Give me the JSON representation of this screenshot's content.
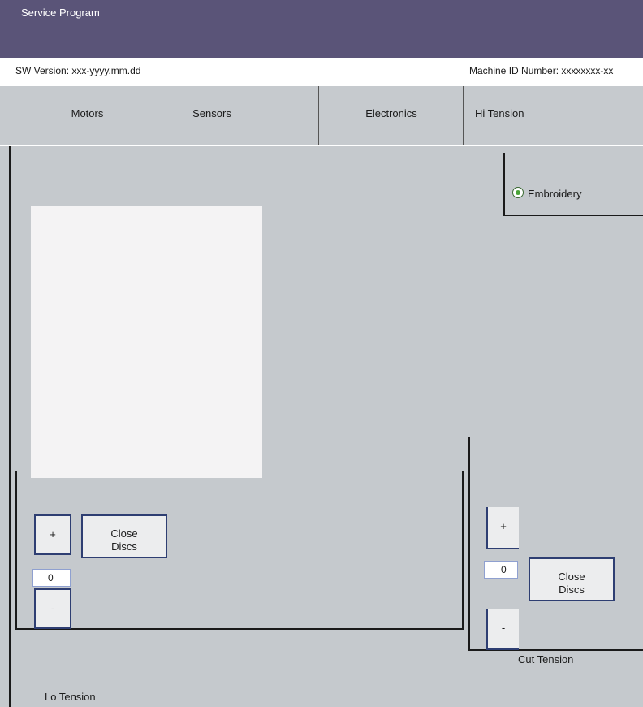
{
  "window": {
    "title": "Service Program"
  },
  "info": {
    "sw_version": "SW Version: xxx-yyyy.mm.dd",
    "machine_id": "Machine ID Number: xxxxxxxx-xx"
  },
  "tabs": [
    {
      "label": "Motors"
    },
    {
      "label": "Sensors"
    },
    {
      "label": "Electronics"
    },
    {
      "label": "Hi Tension"
    }
  ],
  "mode": {
    "embroidery_label": "Embroidery",
    "embroidery_selected": true
  },
  "lo_tension": {
    "label": "Lo Tension",
    "plus_label": "+",
    "minus_label": "-",
    "value": "0",
    "close_discs_label": "Close\nDiscs"
  },
  "cut_tension": {
    "label": "Cut Tension",
    "plus_label": "+",
    "minus_label": "-",
    "value": "0",
    "close_discs_label": "Close\nDiscs"
  }
}
